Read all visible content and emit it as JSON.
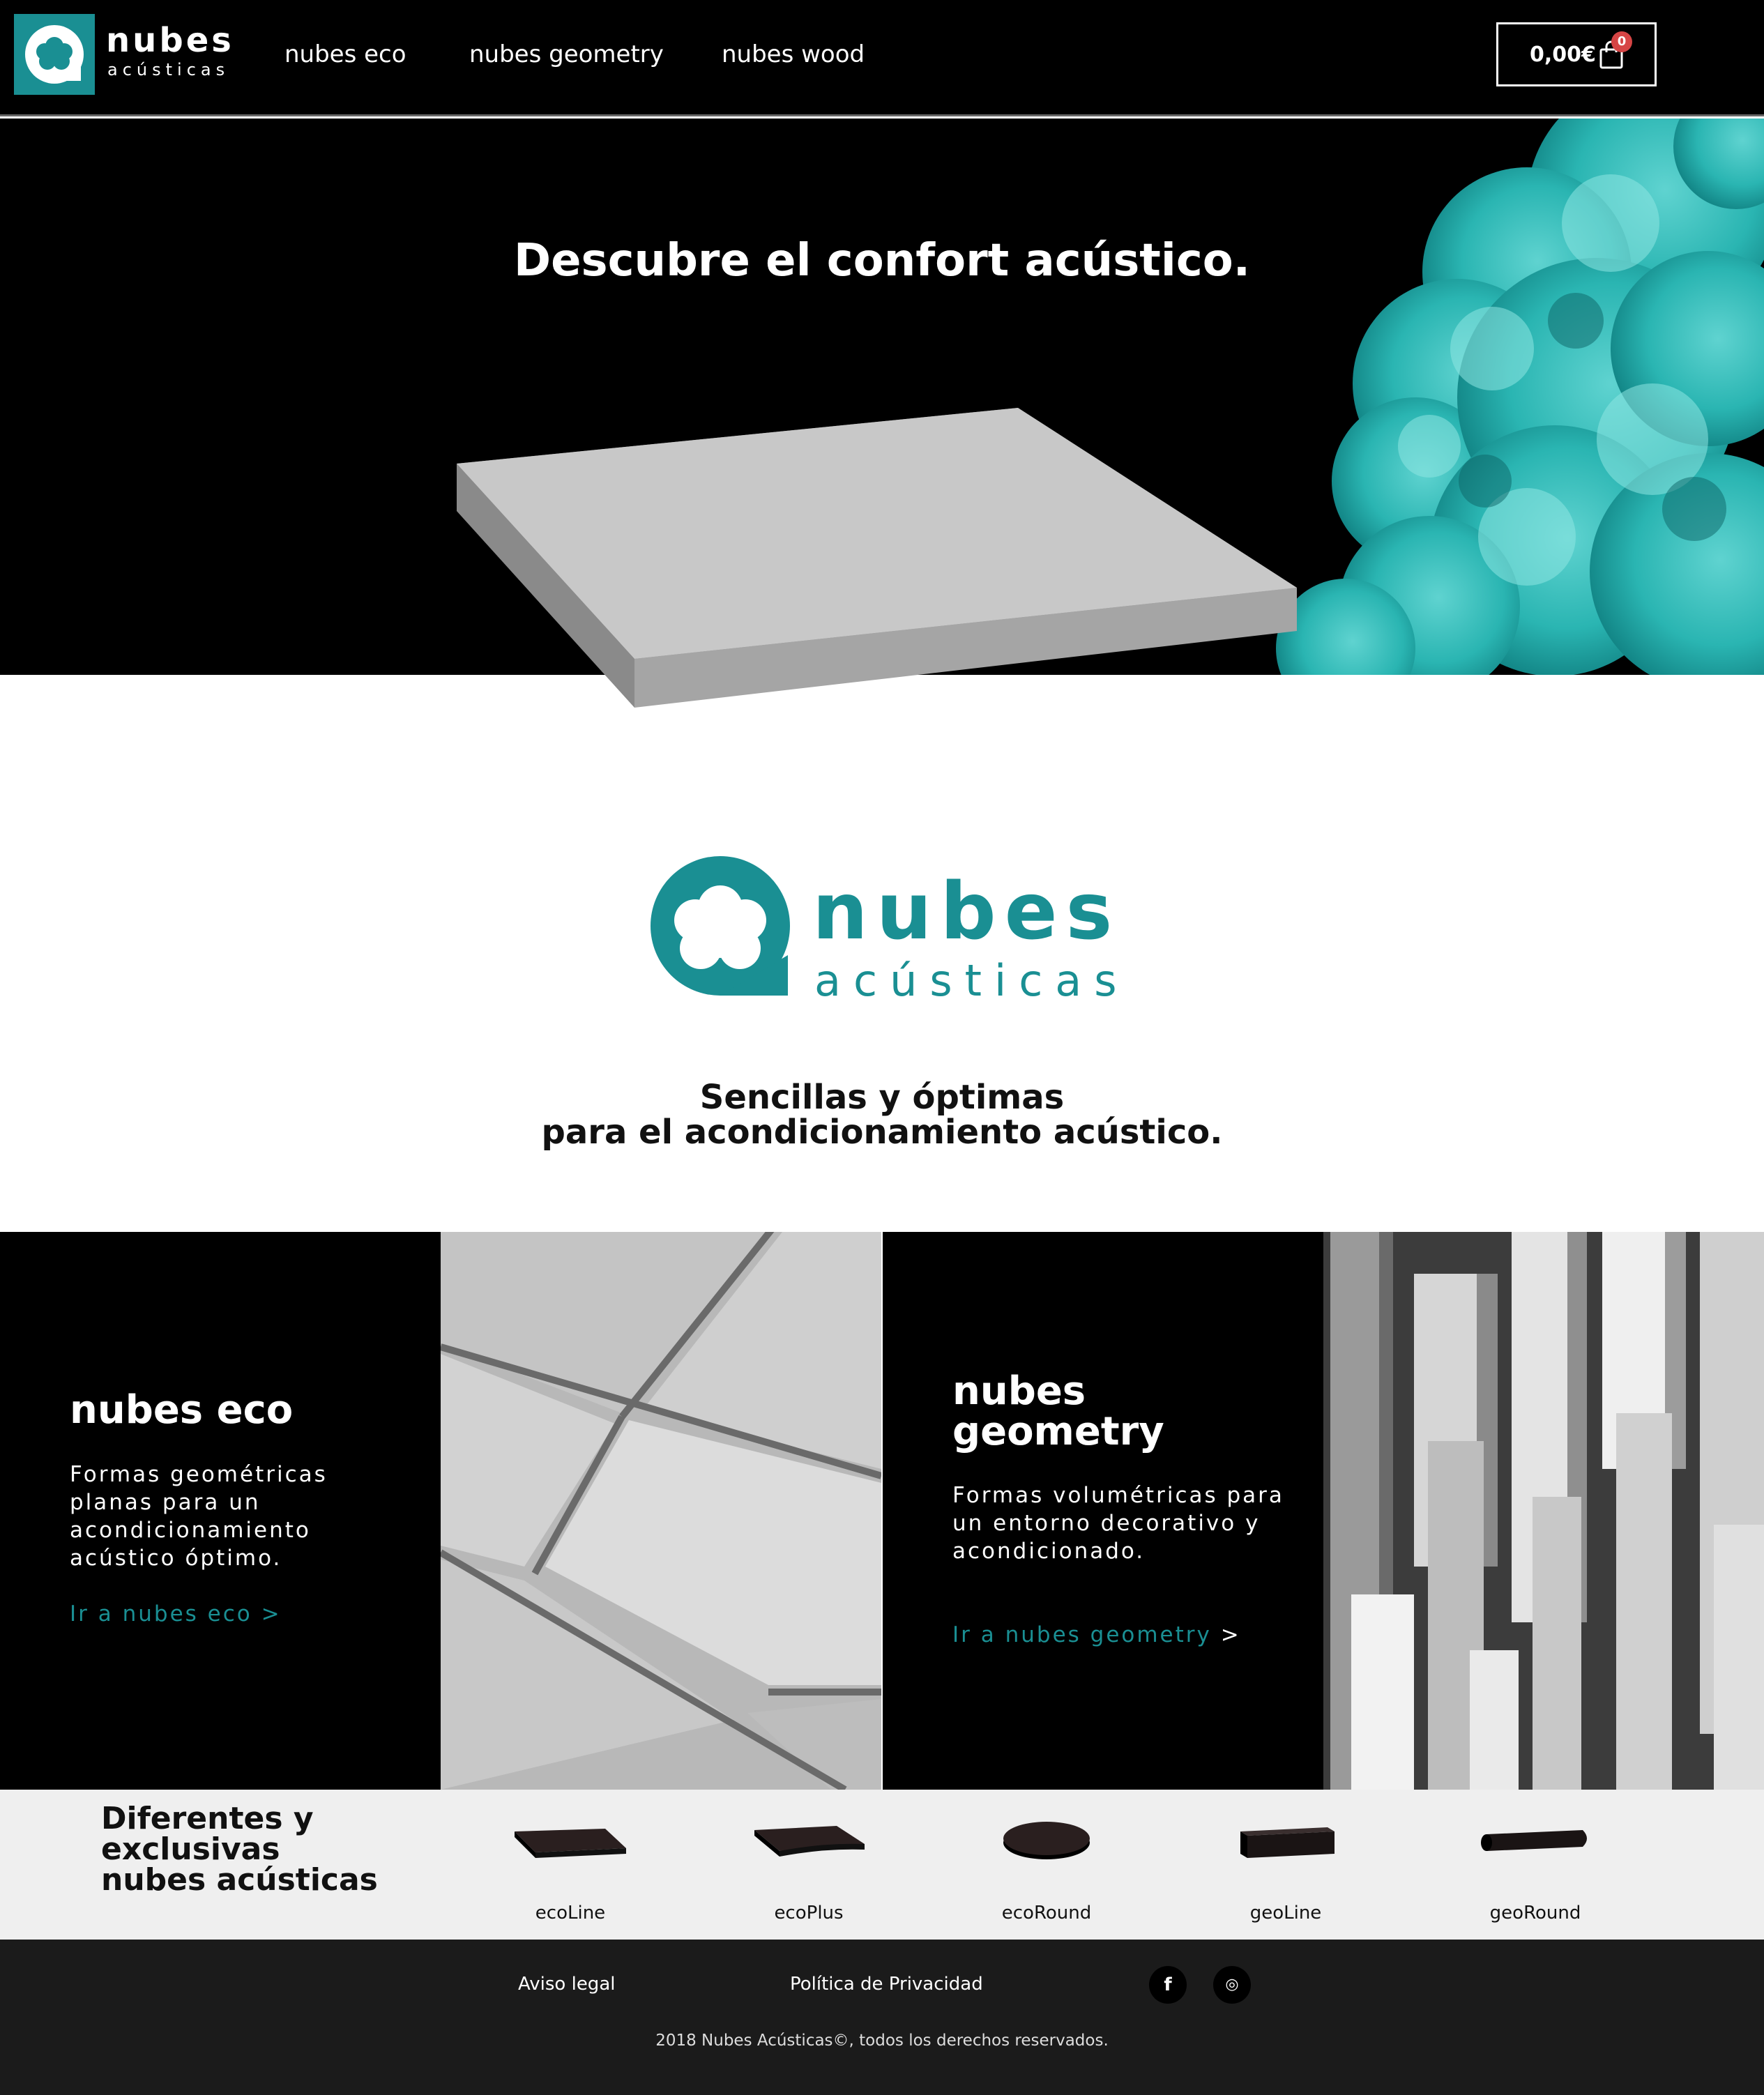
{
  "brand": {
    "name": "nubes",
    "subtitle": "acústicas",
    "accent_color": "#1a8f93"
  },
  "nav": {
    "items": [
      {
        "label": "nubes eco"
      },
      {
        "label": "nubes geometry"
      },
      {
        "label": "nubes wood"
      }
    ]
  },
  "cart": {
    "total": "0,00€",
    "count": "0",
    "icon": "shopping-bag-icon"
  },
  "hero": {
    "title": "Descubre el confort acústico."
  },
  "intro": {
    "tagline_line1": "Sencillas y óptimas",
    "tagline_line2": "para el acondicionamiento acústico."
  },
  "features": [
    {
      "title": "nubes eco",
      "text": "Formas geométricas planas para un acondicionamiento acústico óptimo.",
      "link": "Ir a nubes eco",
      "link_arrow": ">"
    },
    {
      "title": "nubes geometry",
      "text": "Formas volumétricas para un entorno decorativo y acondicionado.",
      "link": "Ir a nubes geometry",
      "link_arrow": ">"
    }
  ],
  "products": {
    "title": "Diferentes y exclusivas nubes acústicas",
    "items": [
      {
        "label": "ecoLine"
      },
      {
        "label": "ecoPlus"
      },
      {
        "label": "ecoRound"
      },
      {
        "label": "geoLine"
      },
      {
        "label": "geoRound"
      }
    ]
  },
  "footer": {
    "links": [
      {
        "label": "Aviso legal"
      },
      {
        "label": "Política de Privacidad"
      }
    ],
    "social": [
      {
        "icon": "facebook-icon",
        "glyph": "f"
      },
      {
        "icon": "instagram-icon",
        "glyph": "◎"
      }
    ],
    "copyright": "2018 Nubes Acústicas©, todos los derechos reservados."
  }
}
